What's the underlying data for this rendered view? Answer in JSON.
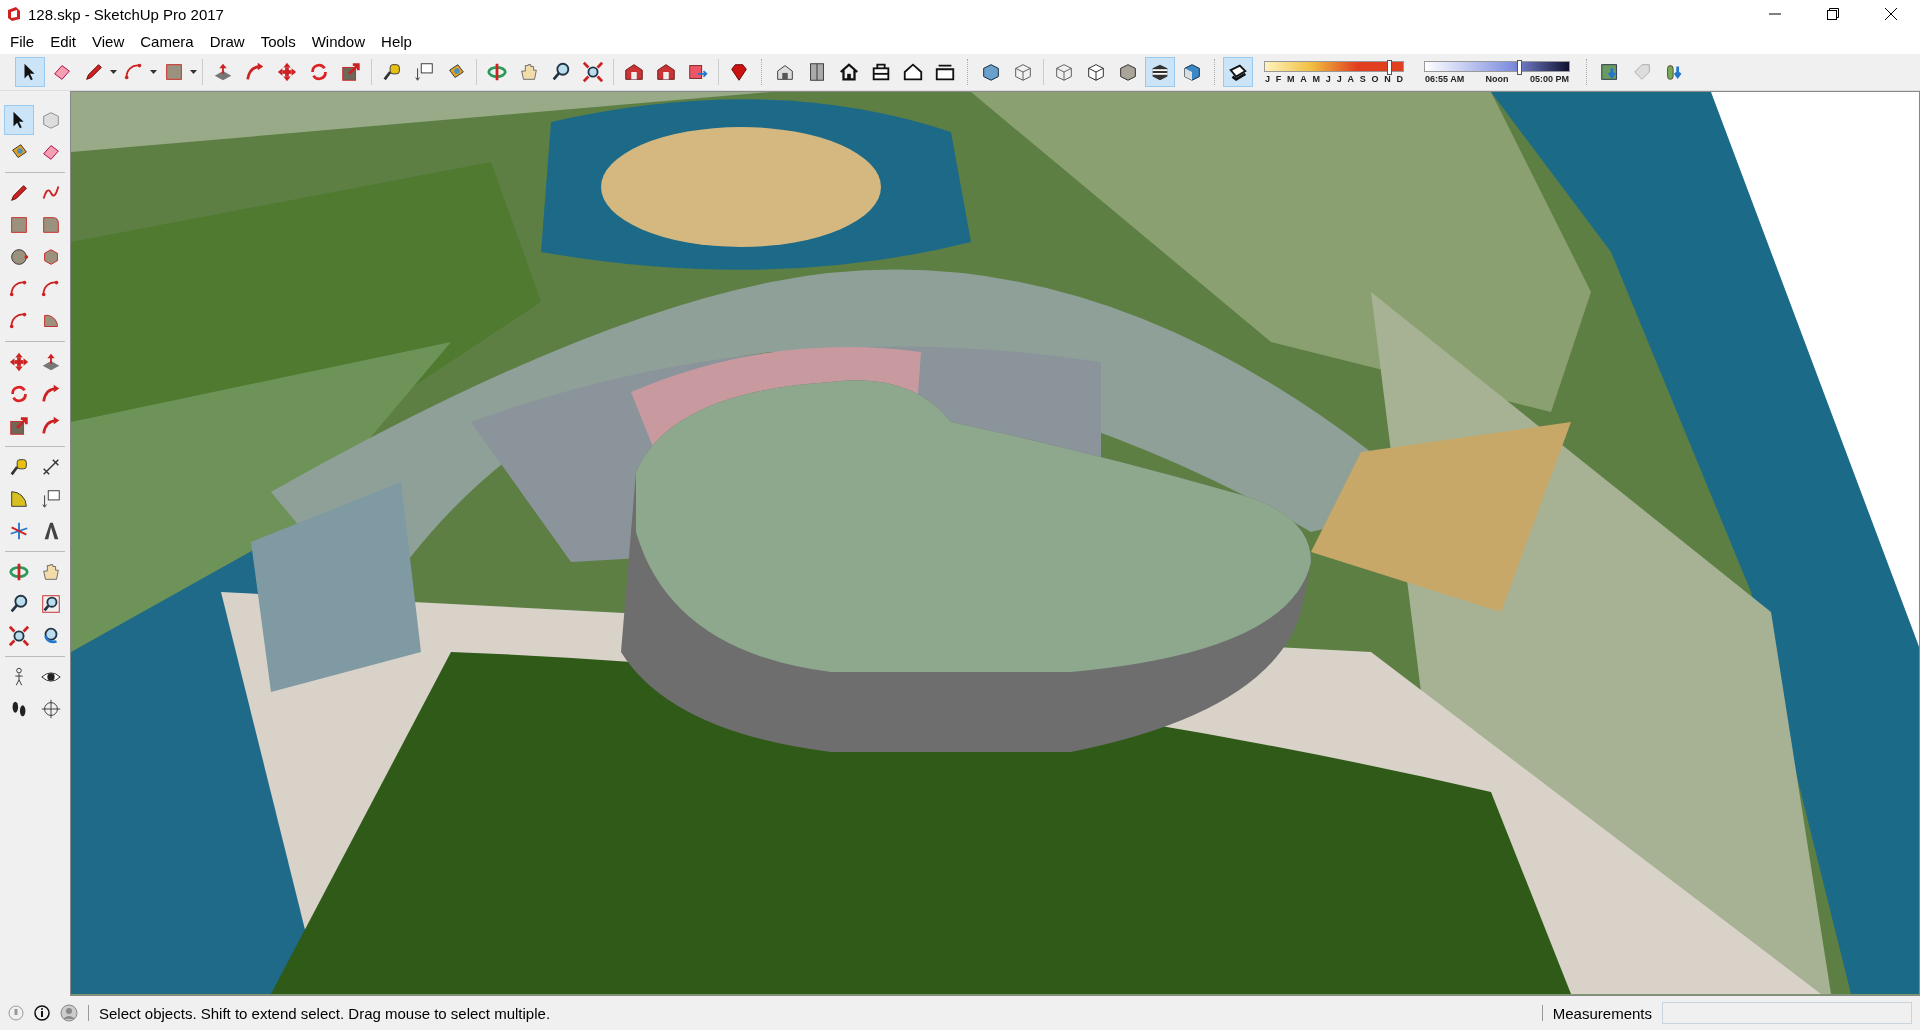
{
  "window": {
    "title": "128.skp - SketchUp Pro 2017"
  },
  "menu": [
    "File",
    "Edit",
    "View",
    "Camera",
    "Draw",
    "Tools",
    "Window",
    "Help"
  ],
  "toolbar": {
    "buttons": [
      {
        "selected": true
      },
      {
        "selected": false
      },
      {
        "selected": false
      },
      {
        "selected": false
      },
      {
        "selected": false
      },
      {
        "selected": false
      },
      {
        "selected": false
      },
      {
        "selected": false
      },
      {
        "selected": false
      },
      {
        "selected": false
      },
      {
        "selected": false
      },
      {
        "selected": false
      },
      {
        "selected": false
      },
      {
        "selected": false
      },
      {
        "selected": false
      },
      {
        "selected": false
      },
      {
        "selected": false
      },
      {
        "selected": false
      },
      {
        "selected": false
      },
      {
        "selected": false
      },
      {
        "selected": false
      },
      {
        "selected": false
      },
      {
        "selected": false
      },
      {
        "selected": false
      },
      {
        "selected": false
      },
      {
        "selected": false
      },
      {
        "selected": false
      },
      {
        "selected": false
      },
      {
        "selected": false
      },
      {
        "selected": false
      },
      {
        "selected": false
      },
      {
        "selected": false
      },
      {
        "selected": true
      },
      {
        "selected": false
      },
      {
        "selected": true
      }
    ],
    "shadow_months": {
      "labels": [
        "J",
        "F",
        "M",
        "A",
        "M",
        "J",
        "J",
        "A",
        "S",
        "O",
        "N",
        "D"
      ],
      "level": 0.9
    },
    "shadow_time": {
      "start": "06:55 AM",
      "middle": "Noon",
      "end": "05:00 PM",
      "level": 0.65
    },
    "extra_buttons": [
      {
        "selected": false
      },
      {
        "selected": false
      },
      {
        "selected": false
      }
    ]
  },
  "side_toolbar": {
    "buttons": [
      {
        "selected": true
      },
      {
        "selected": false
      },
      {
        "selected": false
      },
      {
        "selected": false
      },
      {
        "selected": false
      },
      {
        "selected": false
      },
      {
        "selected": false
      },
      {
        "selected": false
      },
      {
        "selected": false
      },
      {
        "selected": false
      },
      {
        "selected": false
      },
      {
        "selected": false
      },
      {
        "selected": false
      },
      {
        "selected": false
      },
      {
        "selected": false
      },
      {
        "selected": false
      },
      {
        "selected": false
      },
      {
        "selected": false
      },
      {
        "selected": false
      },
      {
        "selected": false
      },
      {
        "selected": false
      },
      {
        "selected": false
      },
      {
        "selected": false
      },
      {
        "selected": false
      },
      {
        "selected": false
      },
      {
        "selected": false
      },
      {
        "selected": false
      },
      {
        "selected": false
      },
      {
        "selected": false
      },
      {
        "selected": false
      },
      {
        "selected": false
      },
      {
        "selected": false
      },
      {
        "selected": false
      },
      {
        "selected": false
      },
      {
        "selected": false
      },
      {
        "selected": false
      }
    ]
  },
  "status_bar": {
    "message": "Select objects. Shift to extend select. Drag mouse to select multiple.",
    "measurements_label": "Measurements"
  }
}
